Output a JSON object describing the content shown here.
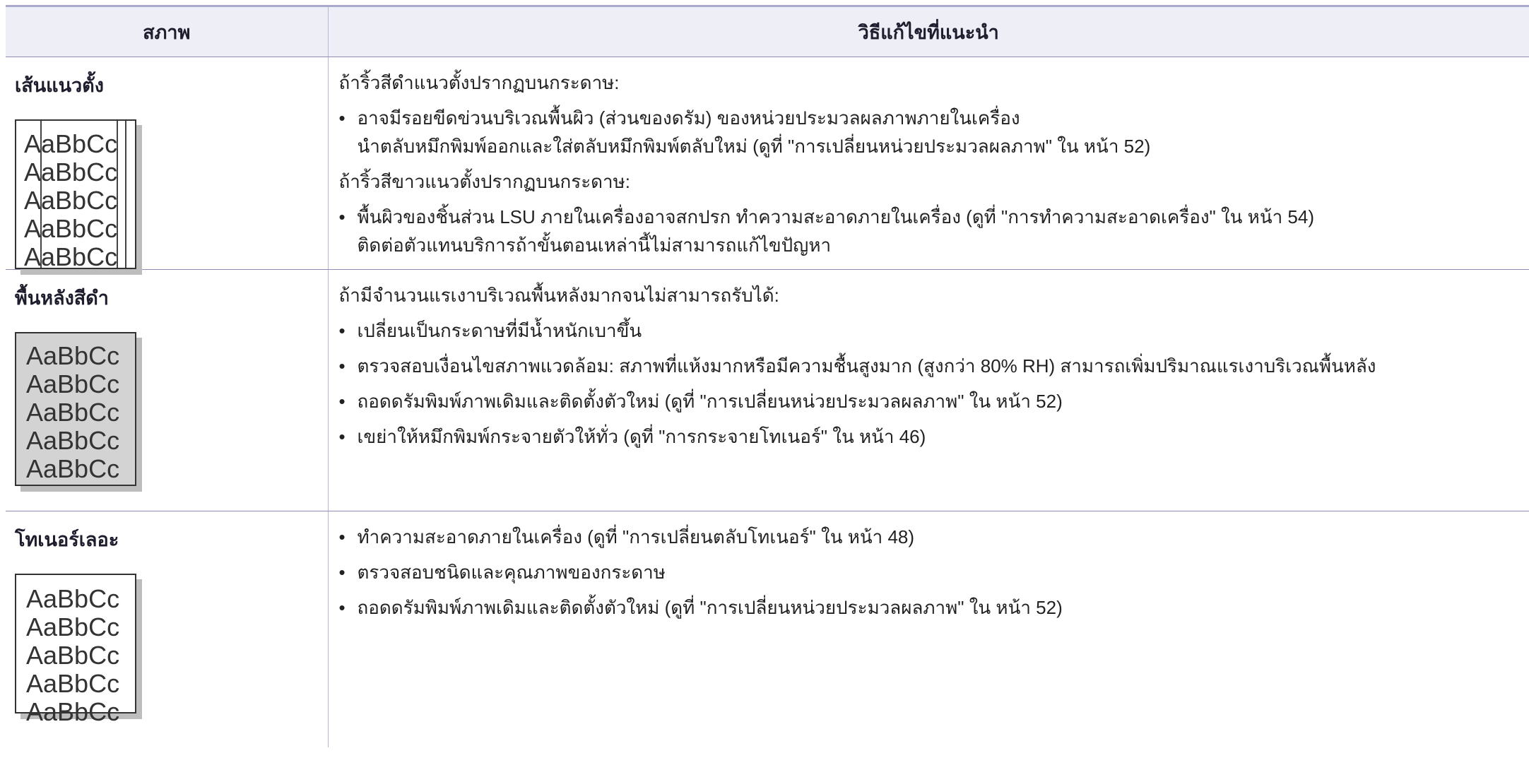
{
  "header": {
    "condition": "สภาพ",
    "solution": "วิธีแก้ไขที่แนะนำ"
  },
  "rows": [
    {
      "condition": "เส้นแนวตั้ง",
      "sample": {
        "style": "vertical-lines",
        "lines": [
          "AaBbCc",
          "AaBbCc",
          "AaBbCc",
          "AaBbCc",
          "AaBbCc"
        ]
      },
      "blocks": [
        {
          "type": "para",
          "text": "ถ้าริ้วสีดำแนวตั้งปรากฏบนกระดาษ:"
        },
        {
          "type": "bullet",
          "lines": [
            "อาจมีรอยขีดข่วนบริเวณพื้นผิว (ส่วนของดรัม) ของหน่วยประมวลผลภาพภายในเครื่อง",
            "นำตลับหมึกพิมพ์ออกและใส่ตลับหมึกพิมพ์ตลับใหม่ (ดูที่ \"การเปลี่ยนหน่วยประมวลผลภาพ\"  ใน หน้า 52)"
          ]
        },
        {
          "type": "para",
          "text": "ถ้าริ้วสีขาวแนวตั้งปรากฏบนกระดาษ:"
        },
        {
          "type": "bullet",
          "lines": [
            "พื้นผิวของชิ้นส่วน LSU ภายในเครื่องอาจสกปรก ทำความสะอาดภายในเครื่อง (ดูที่ \"การทำความสะอาดเครื่อง\"  ใน หน้า 54)",
            "ติดต่อตัวแทนบริการถ้าขั้นตอนเหล่านี้ไม่สามารถแก้ไขปัญหา"
          ]
        }
      ]
    },
    {
      "condition": "พื้นหลังสีดำ",
      "sample": {
        "style": "gray-background",
        "lines": [
          "AaBbCc",
          "AaBbCc",
          "AaBbCc",
          "AaBbCc",
          "AaBbCc"
        ]
      },
      "blocks": [
        {
          "type": "para",
          "text": "ถ้ามีจำนวนแรเงาบริเวณพื้นหลังมากจนไม่สามารถรับได้:"
        },
        {
          "type": "bullet",
          "lines": [
            "เปลี่ยนเป็นกระดาษที่มีน้ำหนักเบาขึ้น"
          ]
        },
        {
          "type": "bullet",
          "lines": [
            "ตรวจสอบเงื่อนไขสภาพแวดล้อม: สภาพที่แห้งมากหรือมีความชื้นสูงมาก (สูงกว่า 80% RH) สามารถเพิ่มปริมาณแรเงาบริเวณพื้นหลัง"
          ]
        },
        {
          "type": "bullet",
          "lines": [
            "ถอดดรัมพิมพ์ภาพเดิมและติดตั้งตัวใหม่ (ดูที่ \"การเปลี่ยนหน่วยประมวลผลภาพ\"  ใน หน้า 52)"
          ]
        },
        {
          "type": "bullet",
          "lines": [
            "เขย่าให้หมึกพิมพ์กระจายตัวให้ทั่ว (ดูที่ \"การกระจายโทเนอร์\"  ใน หน้า 46)"
          ]
        }
      ]
    },
    {
      "condition": "โทเนอร์เลอะ",
      "sample": {
        "style": "smeared",
        "lines": [
          "AaBbCc",
          "AaBbCc",
          "AaBbCc",
          "AaBbCc",
          "AaBbCc"
        ]
      },
      "blocks": [
        {
          "type": "bullet",
          "lines": [
            "ทำความสะอาดภายในเครื่อง (ดูที่ \"การเปลี่ยนตลับโทเนอร์\"  ใน หน้า 48)"
          ]
        },
        {
          "type": "bullet",
          "lines": [
            "ตรวจสอบชนิดและคุณภาพของกระดาษ"
          ]
        },
        {
          "type": "bullet",
          "lines": [
            "ถอดดรัมพิมพ์ภาพเดิมและติดตั้งตัวใหม่ (ดูที่ \"การเปลี่ยนหน่วยประมวลผลภาพ\"  ใน หน้า 52)"
          ]
        }
      ]
    }
  ],
  "bullet_glyph": "•"
}
